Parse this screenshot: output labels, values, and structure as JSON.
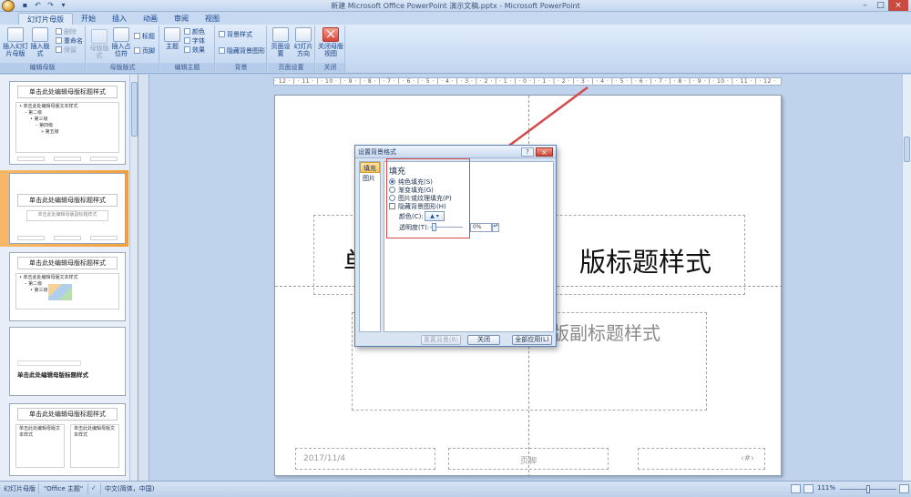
{
  "window": {
    "title": "新建 Microsoft Office PowerPoint 演示文稿.pptx - Microsoft PowerPoint",
    "minimize": "–",
    "restore": "□",
    "close": "×"
  },
  "tabs": [
    "幻灯片母版",
    "开始",
    "插入",
    "动画",
    "审阅",
    "视图"
  ],
  "ribbon": {
    "edit_master": {
      "label": "编辑母版",
      "insert_master": "插入幻灯片母版",
      "insert_layout": "插入版式",
      "delete": "删除",
      "rename": "重命名",
      "preserve": "保留"
    },
    "master_layout": {
      "label": "母版版式",
      "master_layout_btn": "母版版式",
      "insert_placeholder": "插入占位符",
      "title_check": "标题",
      "footer_check": "页脚"
    },
    "edit_theme": {
      "label": "编辑主题",
      "theme": "主题",
      "colors": "颜色",
      "fonts": "字体",
      "effects": "效果"
    },
    "background": {
      "label": "背景",
      "bg_styles": "背景样式",
      "hide_bg": "隐藏背景图形"
    },
    "page_setup": {
      "label": "页面设置",
      "page_setup_btn": "页面设置",
      "orientation": "幻灯片方向"
    },
    "close": {
      "label": "关闭",
      "close_master": "关闭母版视图"
    }
  },
  "thumbnails": {
    "t1_title": "单击此处编辑母版标题样式",
    "t1_body": [
      "• 单击此处编辑母版文本样式",
      "– 第二级",
      "• 第三级",
      "– 第四级",
      "» 第五级"
    ],
    "t2_title": "单击此处编辑母版标题样式",
    "t2_sub": "单击此处编辑母版副标题样式",
    "t3_title": "单击此处编辑母版标题样式",
    "t3_body": [
      "• 单击此处编辑母版文本样式",
      "– 第二级",
      "• 第三级"
    ],
    "t4_title": "单击此处编辑母版标题样式",
    "t5_title": "单击此处编辑母版标题样式",
    "t5_body_left": "单击此处编辑母版文本样式",
    "t5_body_right": "单击此处编辑母版文本样式"
  },
  "ruler": {
    "ticks": "· 12 · | · 11 · | · 10 · | · 9 · | · 8 · | · 7 · | · 6 · | · 5 · | · 4 · | · 3 · | · 2 · | · 1 · | · 0 · | · 1 · | · 2 · | · 3 · | · 4 · | · 5 · | · 6 · | · 7 · | · 8 · | · 9 · | · 10 · | · 11 · | · 12 ·"
  },
  "slide": {
    "title_left": "单",
    "title_right": "版标题样式",
    "subtitle_right": "版副标题样式",
    "date": "2017/11/4",
    "footer": "页脚",
    "page_number": "‹#›"
  },
  "dialog": {
    "title": "设置背景格式",
    "help": "?",
    "close": "×",
    "nav": [
      "填充",
      "图片"
    ],
    "section_title": "填充",
    "options": {
      "solid": "纯色填充(S)",
      "gradient": "渐变填充(G)",
      "picture": "图片或纹理填充(P)",
      "hide_bg": "隐藏背景图形(H)"
    },
    "color_label": "颜色(C):",
    "color_button": "▲ ▾",
    "transparency_label": "透明度(T):",
    "transparency_value": "0%",
    "spin": "▴▾",
    "buttons": {
      "reset": "重置背景(B)",
      "close": "关闭",
      "apply_all": "全部应用(L)"
    }
  },
  "statusbar": {
    "mode": "幻灯片母版",
    "theme": "\"Office 主题\"",
    "language": "中文(简体，中国)",
    "zoom": "111%"
  },
  "colors": {
    "accent_orange": "#f2a03c",
    "annotation_red": "#d44b4b",
    "ribbon_blue": "#15428b"
  }
}
